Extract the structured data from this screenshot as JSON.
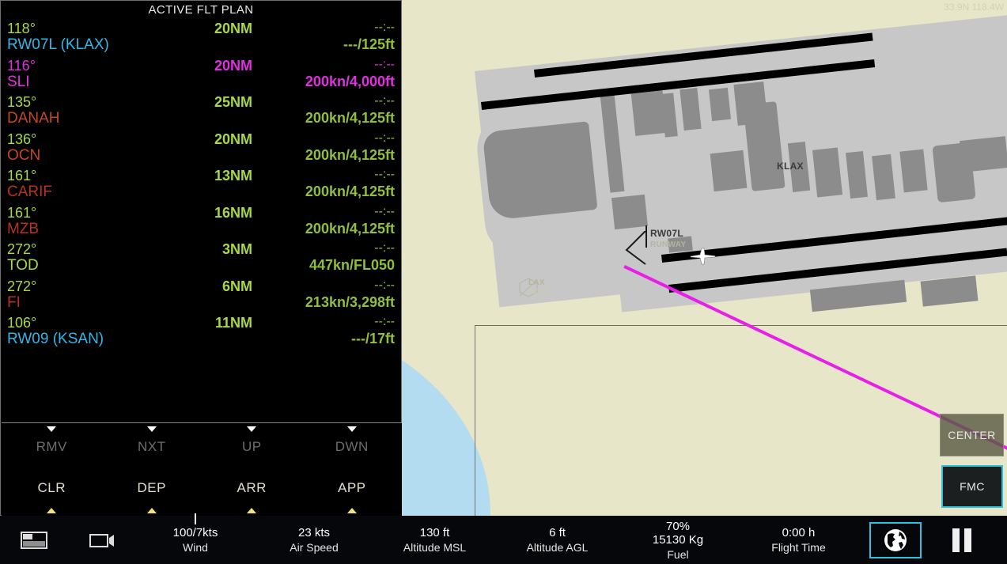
{
  "map": {
    "coordinates": "33.9N 118.4W",
    "labels": {
      "airport": "KLAX",
      "runway_id": "RW07L",
      "runway_sub": "RUNWAY",
      "vor": "LAX",
      "vor_sub": "113.60"
    },
    "aircraft_icon": "aircraft-symbol",
    "route_color": "#e81fe8",
    "land_color": "#e7e6c8",
    "water_color": "#b4dcf0",
    "buttons": {
      "center": "CENTER",
      "fmc": "FMC"
    }
  },
  "flight_plan": {
    "title": "ACTIVE FLT PLAN",
    "columns": [
      "bearing",
      "distance",
      "eta",
      "waypoint",
      "speed_alt"
    ],
    "rows": [
      {
        "bearing": "118°",
        "distance": "20NM",
        "eta": "--:--",
        "waypoint": "RW07L (KLAX)",
        "speed_alt": "---/125ft",
        "brg_class": "cGreen",
        "dist_class": "cGreen",
        "eta_class": "cGreenD",
        "wpt_class": "cCyan",
        "spd_class": "cGreenD"
      },
      {
        "bearing": "116°",
        "distance": "20NM",
        "eta": "--:--",
        "waypoint": "SLI",
        "speed_alt": "200kn/4,000ft",
        "brg_class": "cMag",
        "dist_class": "cMag",
        "eta_class": "cMag",
        "wpt_class": "cMag",
        "spd_class": "cMag"
      },
      {
        "bearing": "135°",
        "distance": "25NM",
        "eta": "--:--",
        "waypoint": "DANAH",
        "speed_alt": "200kn/4,125ft",
        "brg_class": "cGreen",
        "dist_class": "cGreen",
        "eta_class": "cGreenD",
        "wpt_class": "cOrange",
        "spd_class": "cGreenD"
      },
      {
        "bearing": "136°",
        "distance": "20NM",
        "eta": "--:--",
        "waypoint": "OCN",
        "speed_alt": "200kn/4,125ft",
        "brg_class": "cGreen",
        "dist_class": "cGreen",
        "eta_class": "cGreenD",
        "wpt_class": "cOrange",
        "spd_class": "cGreenD"
      },
      {
        "bearing": "161°",
        "distance": "13NM",
        "eta": "--:--",
        "waypoint": "CARIF",
        "speed_alt": "200kn/4,125ft",
        "brg_class": "cGreen",
        "dist_class": "cGreen",
        "eta_class": "cGreenD",
        "wpt_class": "cRed",
        "spd_class": "cGreenD"
      },
      {
        "bearing": "161°",
        "distance": "16NM",
        "eta": "--:--",
        "waypoint": "MZB",
        "speed_alt": "200kn/4,125ft",
        "brg_class": "cGreen",
        "dist_class": "cGreen",
        "eta_class": "cGreenD",
        "wpt_class": "cRed",
        "spd_class": "cGreenD"
      },
      {
        "bearing": "272°",
        "distance": "3NM",
        "eta": "--:--",
        "waypoint": "TOD",
        "speed_alt": "447kn/FL050",
        "brg_class": "cGreen",
        "dist_class": "cGreen",
        "eta_class": "cGreenD",
        "wpt_class": "cGreen",
        "spd_class": "cGreenD"
      },
      {
        "bearing": "272°",
        "distance": "6NM",
        "eta": "--:--",
        "waypoint": "FI",
        "speed_alt": "213kn/3,298ft",
        "brg_class": "cGreen",
        "dist_class": "cGreen",
        "eta_class": "cGreenD",
        "wpt_class": "cRed",
        "spd_class": "cGreenD"
      },
      {
        "bearing": "106°",
        "distance": "11NM",
        "eta": "--:--",
        "waypoint": "RW09 (KSAN)",
        "speed_alt": "---/17ft",
        "brg_class": "cGreen",
        "dist_class": "cGreen",
        "eta_class": "cGreenD",
        "wpt_class": "cCyan",
        "spd_class": "cGreenD"
      }
    ]
  },
  "keypad": {
    "top_row": [
      {
        "label": "RMV",
        "state": "dim"
      },
      {
        "label": "NXT",
        "state": "dim"
      },
      {
        "label": "UP",
        "state": "dim"
      },
      {
        "label": "DWN",
        "state": "dim"
      }
    ],
    "bottom_row": [
      {
        "label": "CLR",
        "state": "lit"
      },
      {
        "label": "DEP",
        "state": "lit"
      },
      {
        "label": "ARR",
        "state": "lit"
      },
      {
        "label": "APP",
        "state": "lit"
      }
    ]
  },
  "status_bar": {
    "panel_icon": "panel-layout-icon",
    "camera_icon": "camera-icon",
    "fields": [
      {
        "value": "100/7kts",
        "label": "Wind"
      },
      {
        "value": "23 kts",
        "label": "Air Speed"
      },
      {
        "value": "130 ft",
        "label": "Altitude MSL"
      },
      {
        "value": "6 ft",
        "label": "Altitude AGL"
      },
      {
        "value": "70%\n15130 Kg",
        "label": "Fuel"
      },
      {
        "value": "0:00 h",
        "label": "Flight Time"
      }
    ],
    "fuel_percent": "70%",
    "fuel_mass": "15130 Kg",
    "globe_icon": "globe-icon",
    "pause_icon": "pause-icon"
  }
}
